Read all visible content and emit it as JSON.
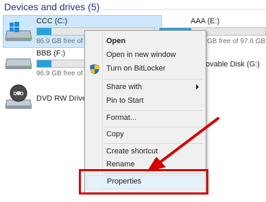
{
  "section": {
    "title": "Devices and drives (5)"
  },
  "drives": {
    "c": {
      "name": "CCC (C:)",
      "free_text": "86.9 GB free of",
      "fill": 0.12
    },
    "e": {
      "name": "AAA (E:)",
      "free_text": "GB free of 97.6 GB",
      "fill": 0.3
    },
    "f": {
      "name": "BBB (F:)",
      "free_text": "96.9 GB free of",
      "fill": 0.12
    },
    "g": {
      "name": "ovable Disk (G:)"
    },
    "dvd": {
      "name": "DVD RW Drive",
      "disc_label": "DVD"
    }
  },
  "context_menu": {
    "items": {
      "open": "Open",
      "open_new_window": "Open in new window",
      "bitlocker": "Turn on BitLocker",
      "share_with": "Share with",
      "pin_to_start": "Pin to Start",
      "format": "Format...",
      "copy": "Copy",
      "create_shortcut": "Create shortcut",
      "rename": "Rename",
      "properties": "Properties"
    }
  },
  "colors": {
    "accent_bar": "#26a0da",
    "selection": "#cce8ff",
    "callout_red": "#d40000",
    "header_blue": "#1e3287"
  },
  "icons": [
    "hard-drive-icon",
    "windows-logo-icon",
    "dvd-drive-icon",
    "shield-icon",
    "submenu-arrow-icon",
    "red-arrow-icon"
  ]
}
